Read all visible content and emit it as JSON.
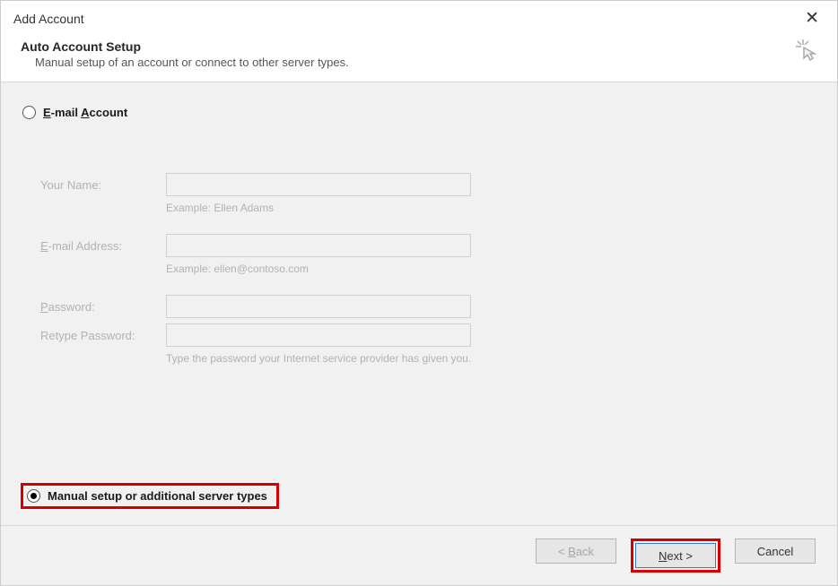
{
  "titlebar": {
    "title": "Add Account",
    "close": "✕"
  },
  "header": {
    "title": "Auto Account Setup",
    "subtitle": "Manual setup of an account or connect to other server types."
  },
  "options": {
    "email_account_label": "E-mail Account",
    "manual_setup_label": "Manual setup or additional server types"
  },
  "form": {
    "name_label": "Your Name:",
    "name_hint": "Example: Ellen Adams",
    "email_label": "E-mail Address:",
    "email_hint": "Example: ellen@contoso.com",
    "password_label": "Password:",
    "retype_label": "Retype Password:",
    "password_hint": "Type the password your Internet service provider has given you."
  },
  "footer": {
    "back": "< Back",
    "next": "Next >",
    "cancel": "Cancel"
  }
}
